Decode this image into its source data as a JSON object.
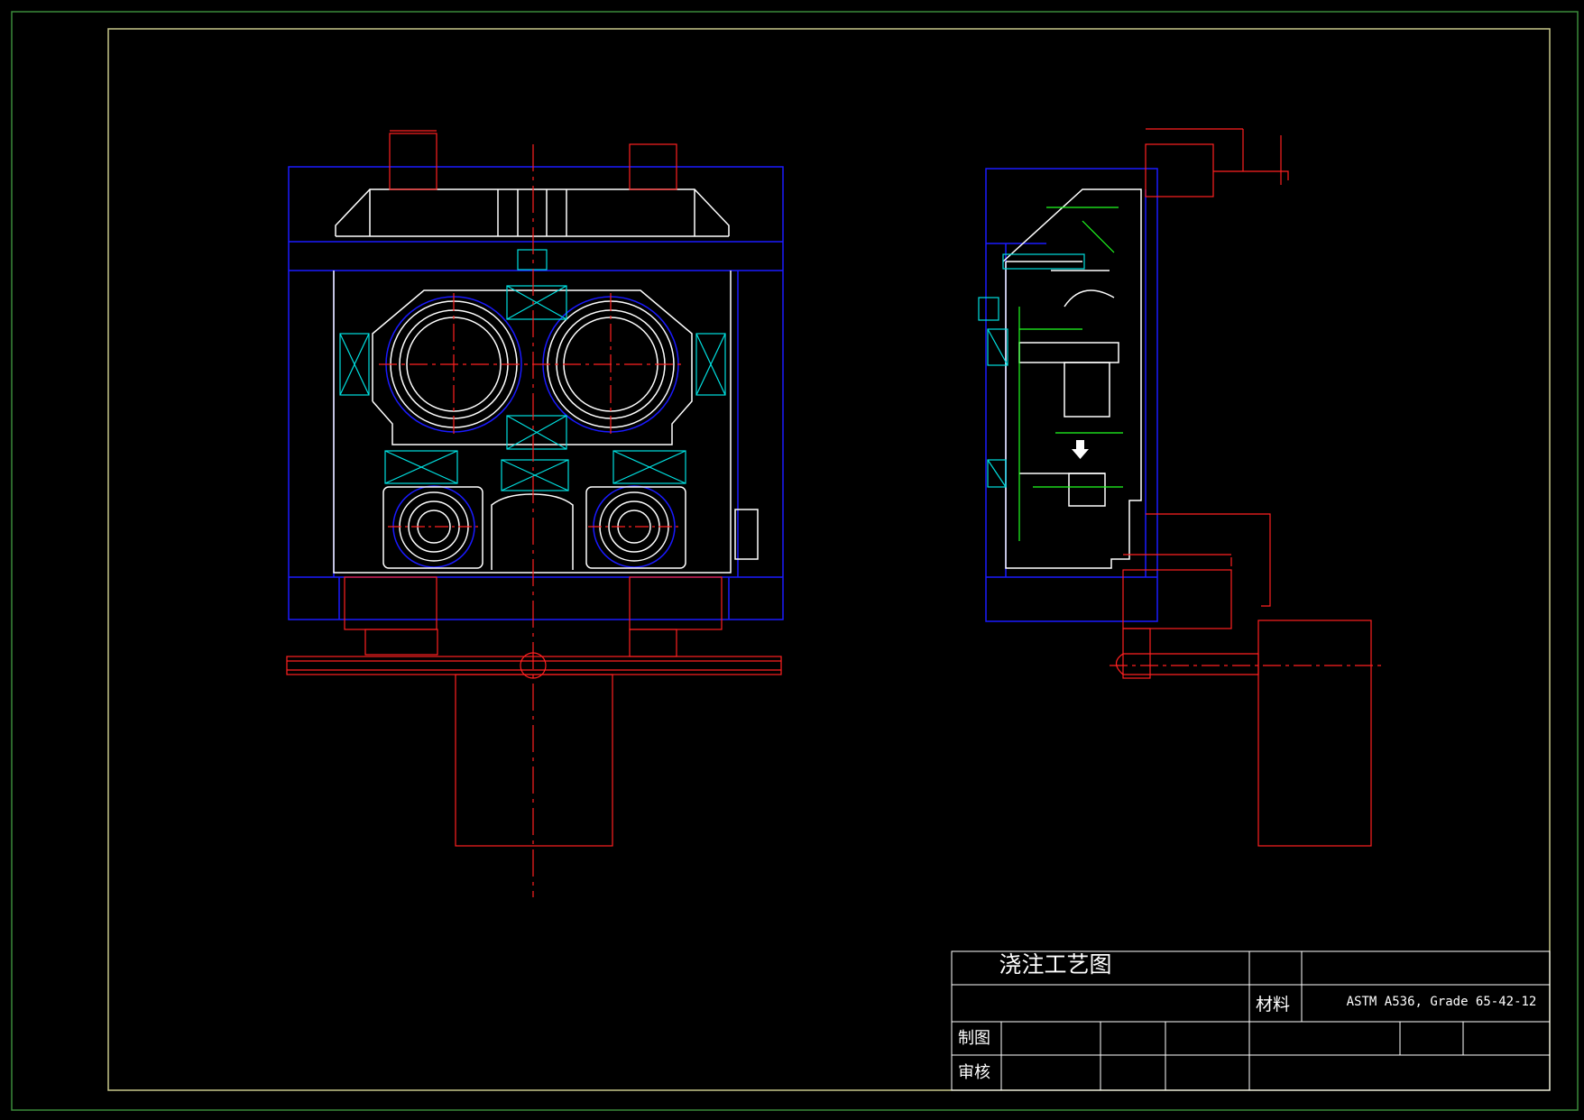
{
  "title_block": {
    "title": "浇注工艺图",
    "material_label": "材料",
    "material_value": "ASTM A536, Grade 65-42-12",
    "drawn_by_label": "制图",
    "checked_by_label": "审核"
  },
  "colors": {
    "background": "#000000",
    "frame": "#c8c88a",
    "outer_frame": "#3a8a3a",
    "line_white": "#ffffff",
    "line_blue": "#1a1aff",
    "line_red": "#ff2020",
    "line_cyan": "#00e0e0",
    "line_green": "#20ff20",
    "line_yellow": "#e0e000"
  }
}
